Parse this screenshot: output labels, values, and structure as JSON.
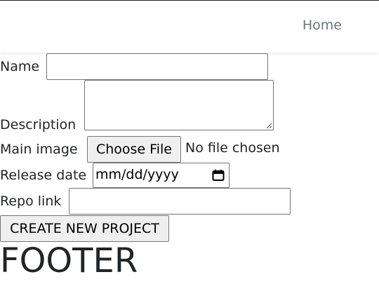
{
  "navbar": {
    "home_label": "Home"
  },
  "form": {
    "name_label": "Name",
    "name_value": "",
    "description_label": "Description",
    "description_value": "",
    "main_image_label": "Main image",
    "file_button_label": "Choose File",
    "file_status": "No file chosen",
    "release_date_label": "Release date",
    "release_date_placeholder": "mm/dd/yyyy",
    "repo_link_label": "Repo link",
    "repo_link_value": "",
    "submit_label": "CREATE NEW PROJECT"
  },
  "footer": {
    "text": "FOOTER"
  },
  "colors": {
    "text": "#212529",
    "nav_link": "#6c757d",
    "button_bg": "#efefef",
    "border": "#767676"
  },
  "icons": {
    "date_picker": "calendar-icon"
  }
}
